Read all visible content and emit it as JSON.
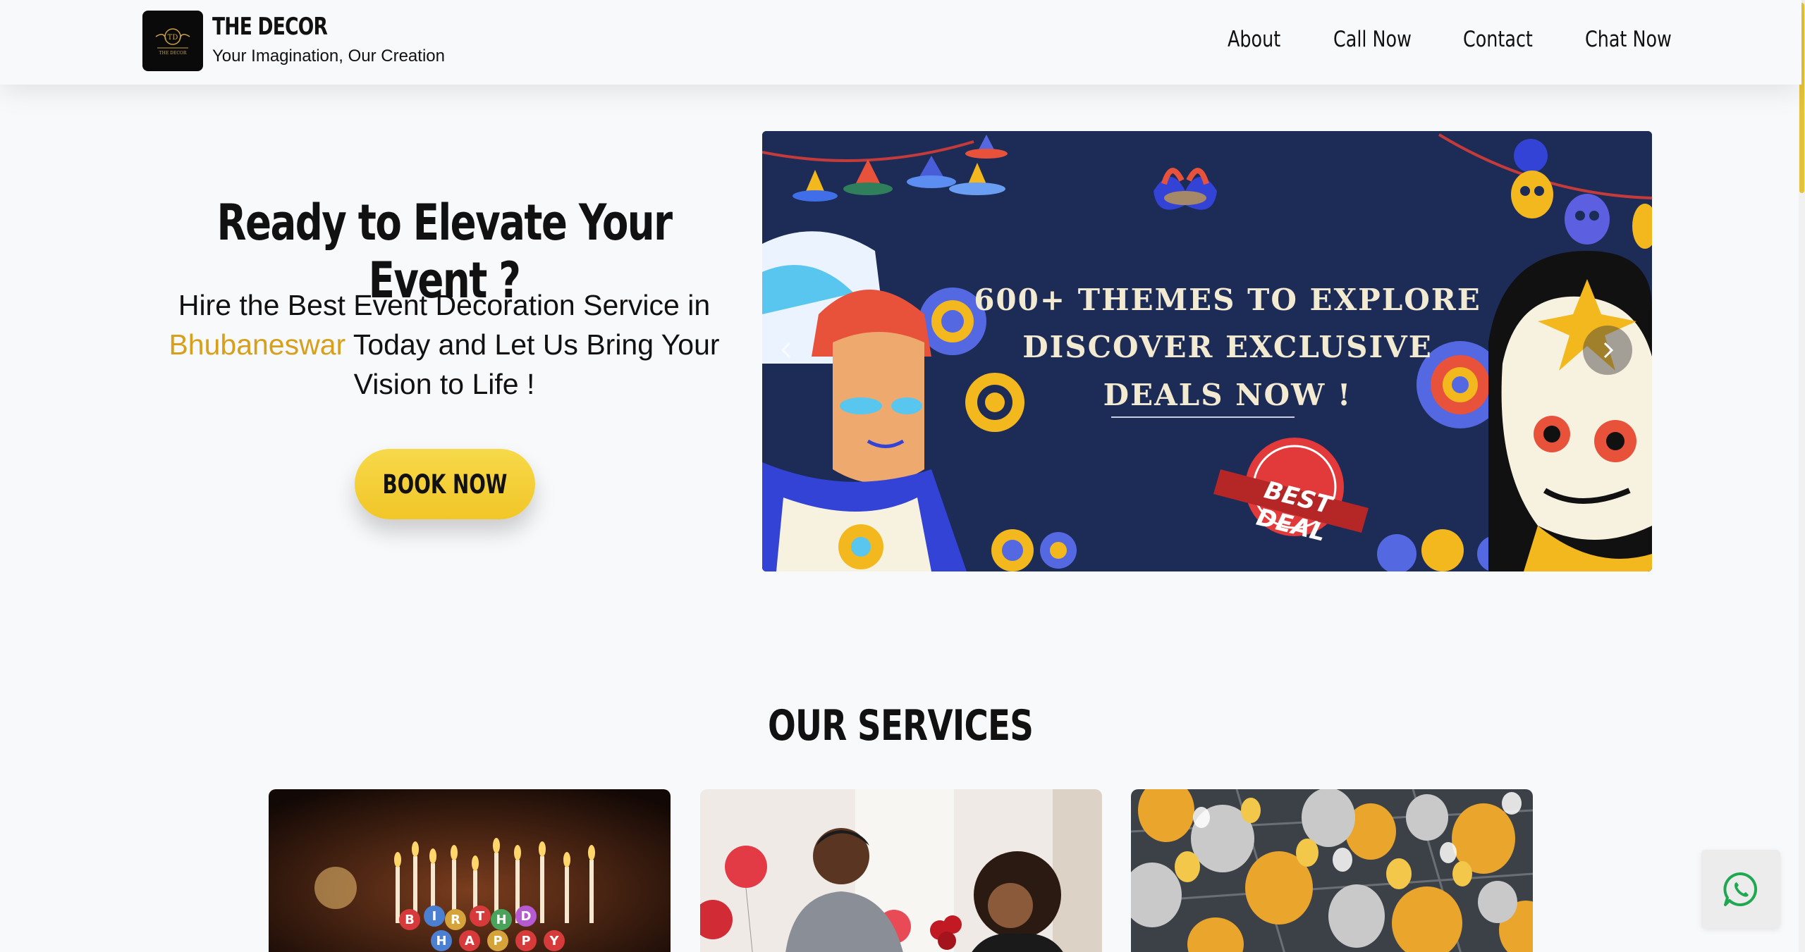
{
  "header": {
    "brand_name": "THE DECOR",
    "brand_tagline": "Your Imagination, Our Creation",
    "logo_text": "THE DECOR"
  },
  "nav": {
    "items": [
      {
        "label": "About"
      },
      {
        "label": "Call Now"
      },
      {
        "label": "Contact"
      },
      {
        "label": "Chat Now"
      }
    ]
  },
  "hero": {
    "title": "Ready to Elevate Your Event ?",
    "text_before": "Hire the Best Event Decoration Service in ",
    "city": "Bhubaneswar",
    "text_after": " Today and Let Us Bring Your Vision to Life !",
    "cta_label": "BOOK NOW"
  },
  "carousel": {
    "line1": "600+ THEMES TO EXPLORE",
    "line2": "DISCOVER EXCLUSIVE",
    "line3": "DEALS NOW !",
    "badge": "BEST DEAL"
  },
  "services": {
    "title": "OUR SERVICES",
    "cards": [
      {
        "name": "birthday",
        "candle_letters": "BIRTHDAY HAPPY"
      },
      {
        "name": "proposal"
      },
      {
        "name": "balloons"
      }
    ]
  },
  "colors": {
    "accent": "#f1c628",
    "city": "#d89f1a",
    "carousel_bg": "#1d2b57",
    "whatsapp": "#1fa851"
  },
  "icons": {
    "whatsapp": "whatsapp-icon",
    "next": "chevron-right-icon",
    "prev": "chevron-left-icon"
  }
}
